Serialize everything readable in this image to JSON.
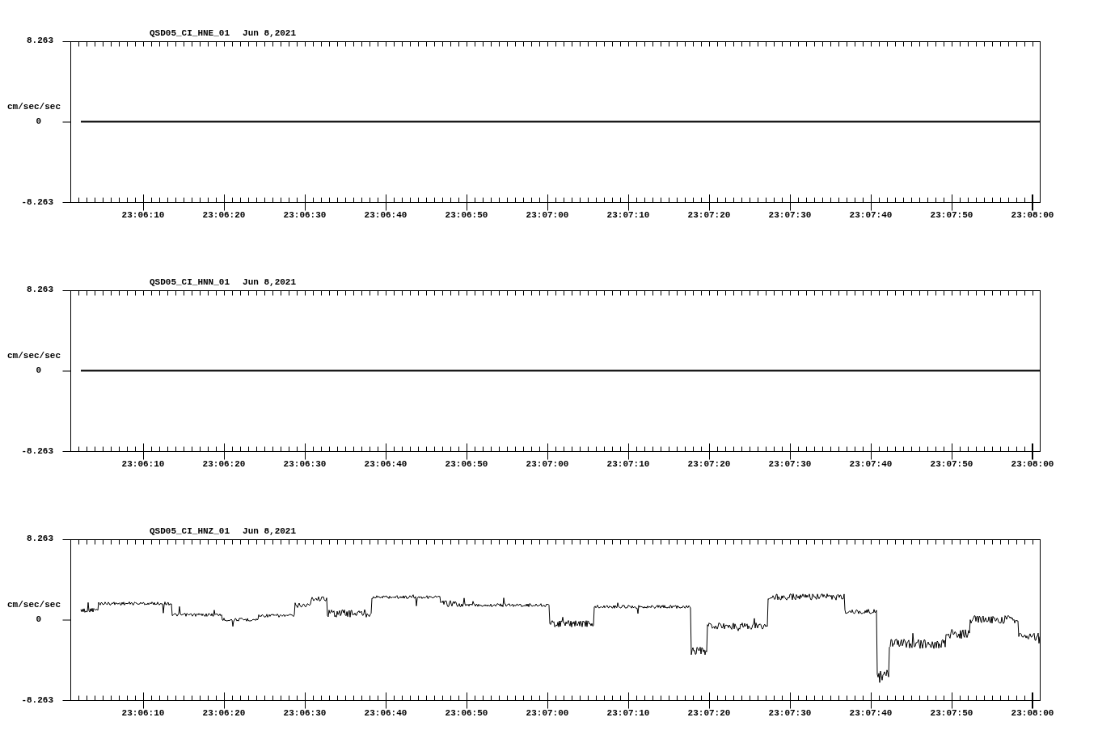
{
  "panels": [
    {
      "channel": "QSD05_CI_HNE_01",
      "date": "Jun 8,2021",
      "unit": "cm/sec/sec",
      "y_ticks": [
        "8.263",
        "0",
        "-8.263"
      ],
      "x_ticks": [
        "23:06:10",
        "23:06:20",
        "23:06:30",
        "23:06:40",
        "23:06:50",
        "23:07:00",
        "23:07:10",
        "23:07:20",
        "23:07:30",
        "23:07:40",
        "23:07:50",
        "23:08:00"
      ],
      "trace": {
        "kind": "flat"
      }
    },
    {
      "channel": "QSD05_CI_HNN_01",
      "date": "Jun 8,2021",
      "unit": "cm/sec/sec",
      "y_ticks": [
        "8.263",
        "0",
        "-8.263"
      ],
      "x_ticks": [
        "23:06:10",
        "23:06:20",
        "23:06:30",
        "23:06:40",
        "23:06:50",
        "23:07:00",
        "23:07:10",
        "23:07:20",
        "23:07:30",
        "23:07:40",
        "23:07:50",
        "23:08:00"
      ],
      "trace": {
        "kind": "flat"
      }
    },
    {
      "channel": "QSD05_CI_HNZ_01",
      "date": "Jun 8,2021",
      "unit": "cm/sec/sec",
      "y_ticks": [
        "8.263",
        "0",
        "-8.263"
      ],
      "x_ticks": [
        "23:06:10",
        "23:06:20",
        "23:06:30",
        "23:06:40",
        "23:06:50",
        "23:07:00",
        "23:07:10",
        "23:07:20",
        "23:07:30",
        "23:07:40",
        "23:07:50",
        "23:08:00"
      ],
      "trace": {
        "kind": "signal"
      }
    }
  ]
}
